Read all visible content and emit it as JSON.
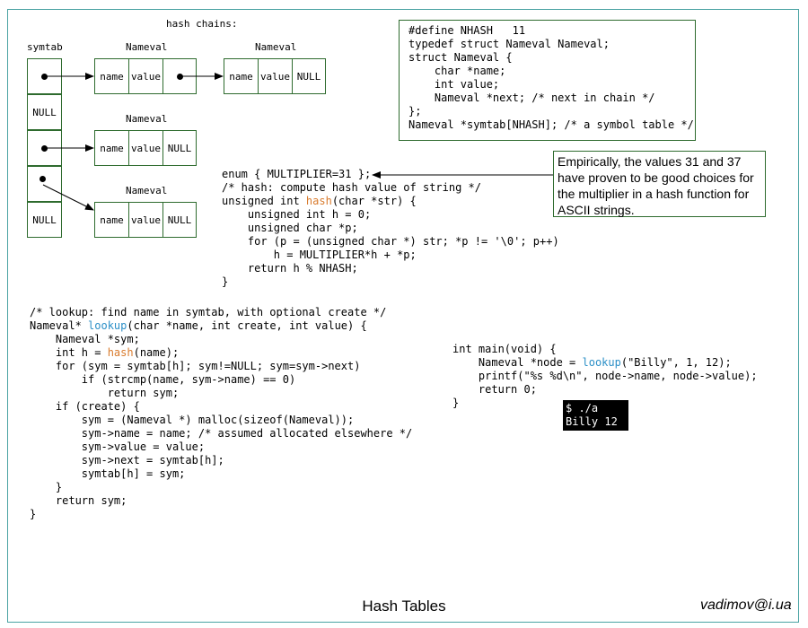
{
  "diagram": {
    "chains_title": "hash chains:",
    "symtab_label": "symtab",
    "symtab_slots": [
      "",
      "NULL",
      "",
      "",
      "NULL"
    ],
    "node_title": "Nameval",
    "nodes": [
      {
        "name": "name",
        "value": "value",
        "next": ""
      },
      {
        "name": "name",
        "value": "value",
        "next": "NULL"
      },
      {
        "name": "name",
        "value": "value",
        "next": "NULL"
      },
      {
        "name": "name",
        "value": "value",
        "next": "NULL"
      }
    ]
  },
  "define_block": "#define NHASH   11\ntypedef struct Nameval Nameval;\nstruct Nameval {\n    char *name;\n    int value;\n    Nameval *next; /* next in chain */\n};\nNameval *symtab[NHASH]; /* a symbol table */",
  "note": "Empirically, the values 31 and 37 have proven to be good choices for the multiplier in a hash function for ASCII strings.",
  "hash_code": {
    "l1": "enum { MULTIPLIER=31 };",
    "l2": "/* hash: compute hash value of string */",
    "l3_pre": "unsigned int ",
    "l3_fn": "hash",
    "l3_post": "(char *str) {",
    "l4": "    unsigned int h = 0;",
    "l5": "    unsigned char *p;",
    "l6": "    for (p = (unsigned char *) str; *p != '\\0'; p++)",
    "l7": "        h = MULTIPLIER*h + *p;",
    "l8": "    return h % NHASH;",
    "l9": "}"
  },
  "lookup_code": {
    "l1": "/* lookup: find name in symtab, with optional create */",
    "l2_pre": "Nameval* ",
    "l2_fn": "lookup",
    "l2_post": "(char *name, int create, int value) {",
    "l3": "    Nameval *sym;",
    "l4_pre": "    int h = ",
    "l4_fn": "hash",
    "l4_post": "(name);",
    "l5": "    for (sym = symtab[h]; sym!=NULL; sym=sym->next)",
    "l6": "        if (strcmp(name, sym->name) == 0)",
    "l7": "            return sym;",
    "l8": "    if (create) {",
    "l9": "        sym = (Nameval *) malloc(sizeof(Nameval));",
    "l10": "        sym->name = name; /* assumed allocated elsewhere */",
    "l11": "        sym->value = value;",
    "l12": "        sym->next = symtab[h];",
    "l13": "        symtab[h] = sym;",
    "l14": "    }",
    "l15": "    return sym;",
    "l16": "}"
  },
  "main_code": {
    "l1": "int main(void) {",
    "l2_pre": "    Nameval *node = ",
    "l2_fn": "lookup",
    "l2_post": "(\"Billy\", 1, 12);",
    "l3": "    printf(\"%s %d\\n\", node->name, node->value);",
    "l4": "    return 0;",
    "l5": "}"
  },
  "terminal": {
    "l1": "$ ./a",
    "l2": "Billy 12"
  },
  "footer": {
    "title": "Hash Tables",
    "author": "vadimov@i.ua"
  },
  "colors": {
    "function_orange": "#d97b2d",
    "function_blue": "#2b8fc7",
    "box_border": "#2e6b2e",
    "frame_border": "#4aa3a3"
  }
}
